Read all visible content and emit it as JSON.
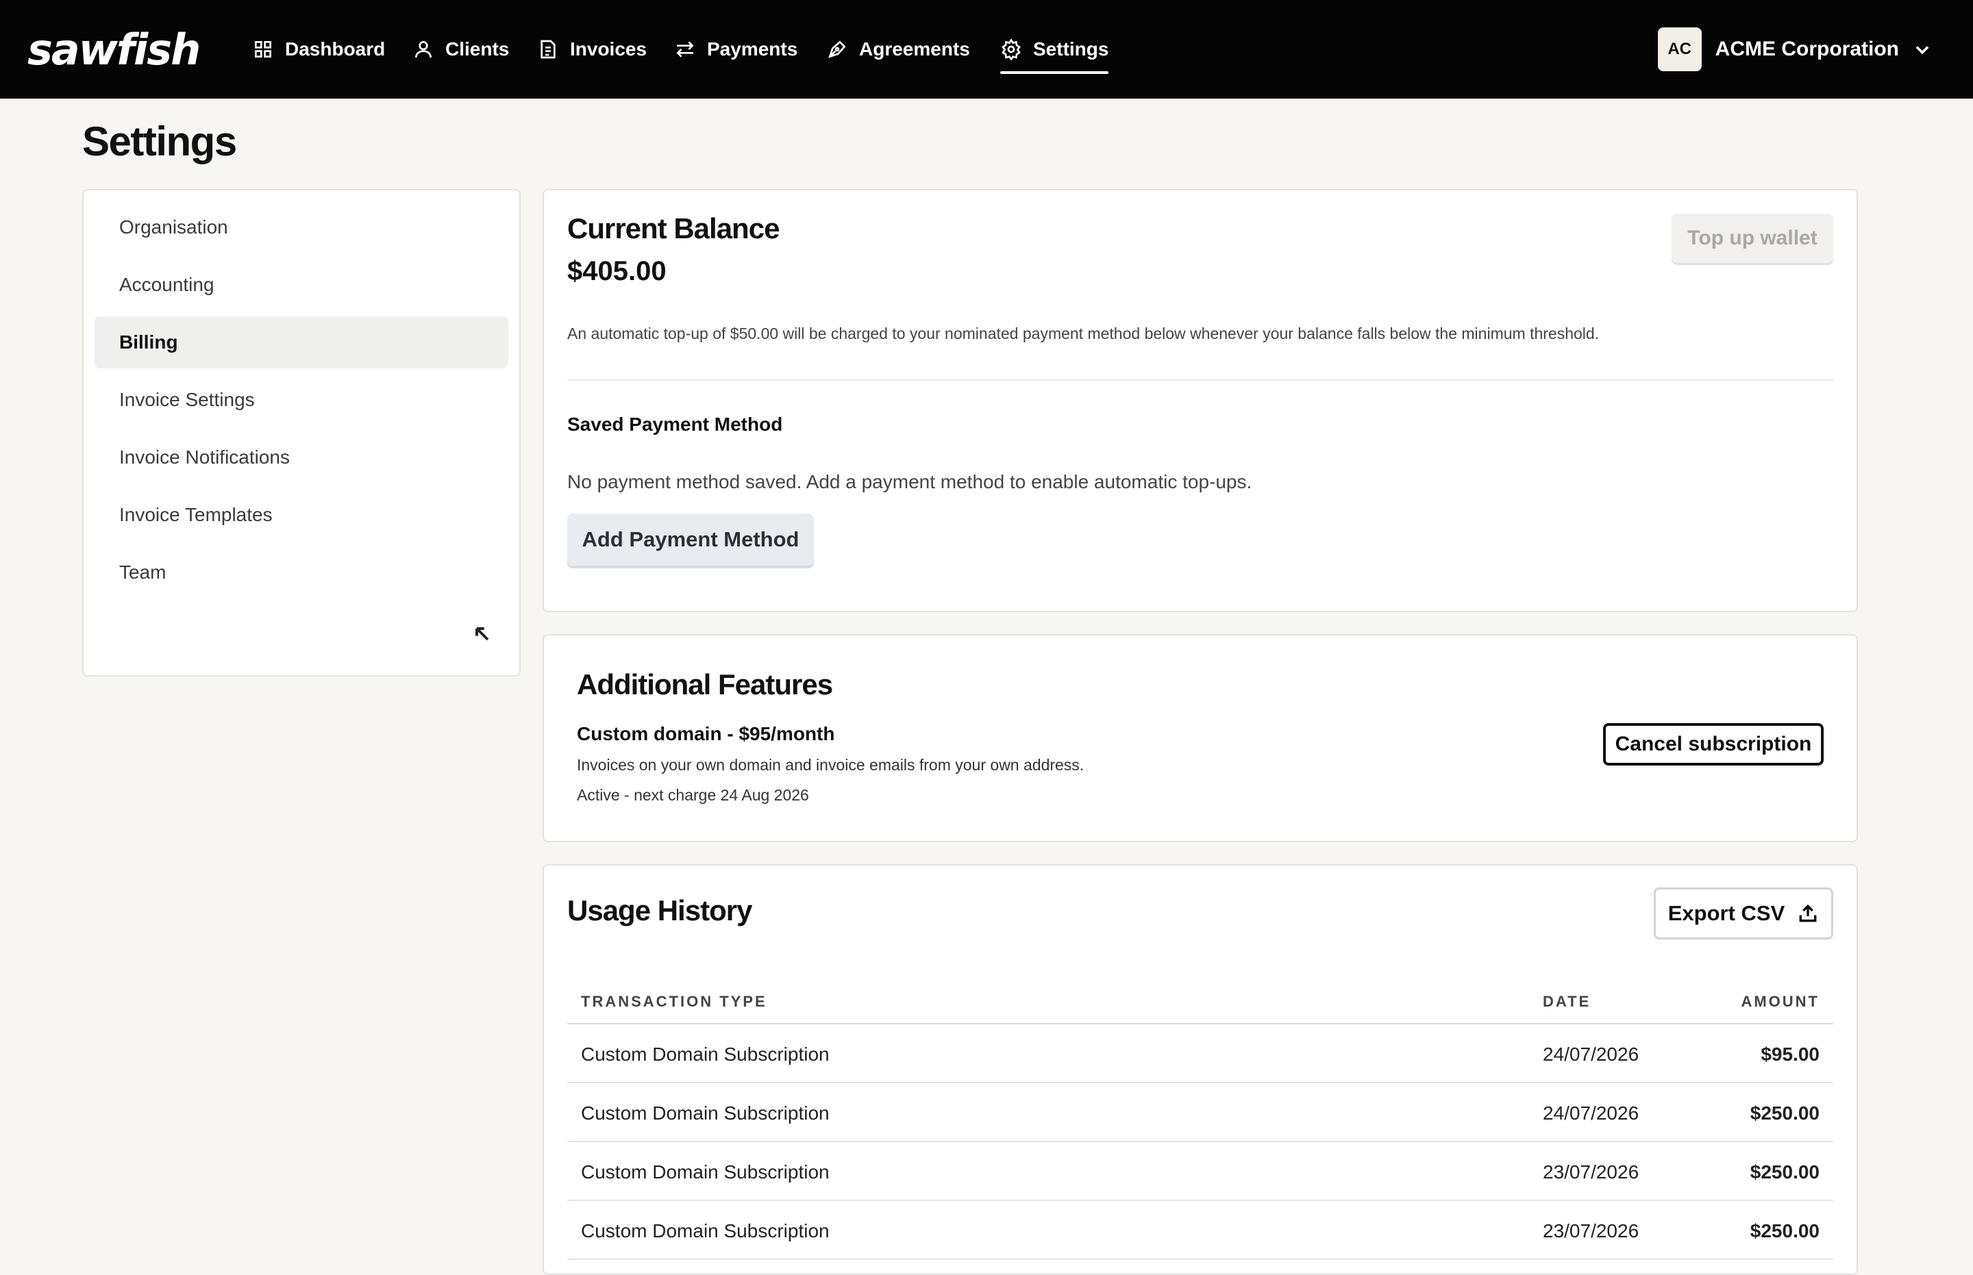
{
  "app": {
    "logo_text": "sawfish"
  },
  "nav": {
    "items": [
      {
        "label": "Dashboard",
        "icon": "grid-icon"
      },
      {
        "label": "Clients",
        "icon": "user-icon"
      },
      {
        "label": "Invoices",
        "icon": "invoice-icon"
      },
      {
        "label": "Payments",
        "icon": "arrows-icon"
      },
      {
        "label": "Agreements",
        "icon": "pen-icon"
      },
      {
        "label": "Settings",
        "icon": "gear-icon",
        "active": true
      }
    ],
    "org": {
      "initials": "AC",
      "name": "ACME Corporation"
    }
  },
  "page": {
    "title": "Settings"
  },
  "sidebar": {
    "items": [
      {
        "label": "Organisation"
      },
      {
        "label": "Accounting"
      },
      {
        "label": "Billing",
        "active": true
      },
      {
        "label": "Invoice Settings"
      },
      {
        "label": "Invoice Notifications"
      },
      {
        "label": "Invoice Templates"
      },
      {
        "label": "Team"
      }
    ]
  },
  "balance": {
    "title": "Current Balance",
    "amount": "$405.00",
    "topup_label": "Top up wallet",
    "info": "An automatic top-up of $50.00 will be charged to your nominated payment method below whenever your balance falls below the minimum threshold.",
    "saved_method_title": "Saved Payment Method",
    "no_method_text": "No payment method saved. Add a payment method to enable automatic top-ups.",
    "add_method_label": "Add Payment Method"
  },
  "features": {
    "title": "Additional Features",
    "name": "Custom domain - $95/month",
    "description": "Invoices on your own domain and invoice emails from your own address.",
    "status": "Active - next charge 24 Aug 2026",
    "cancel_label": "Cancel subscription"
  },
  "usage": {
    "title": "Usage History",
    "export_label": "Export CSV",
    "columns": [
      "TRANSACTION TYPE",
      "DATE",
      "AMOUNT"
    ],
    "rows": [
      {
        "type": "Custom Domain Subscription",
        "date": "24/07/2026",
        "amount": "$95.00"
      },
      {
        "type": "Custom Domain Subscription",
        "date": "24/07/2026",
        "amount": "$250.00"
      },
      {
        "type": "Custom Domain Subscription",
        "date": "23/07/2026",
        "amount": "$250.00"
      },
      {
        "type": "Custom Domain Subscription",
        "date": "23/07/2026",
        "amount": "$250.00"
      }
    ]
  }
}
